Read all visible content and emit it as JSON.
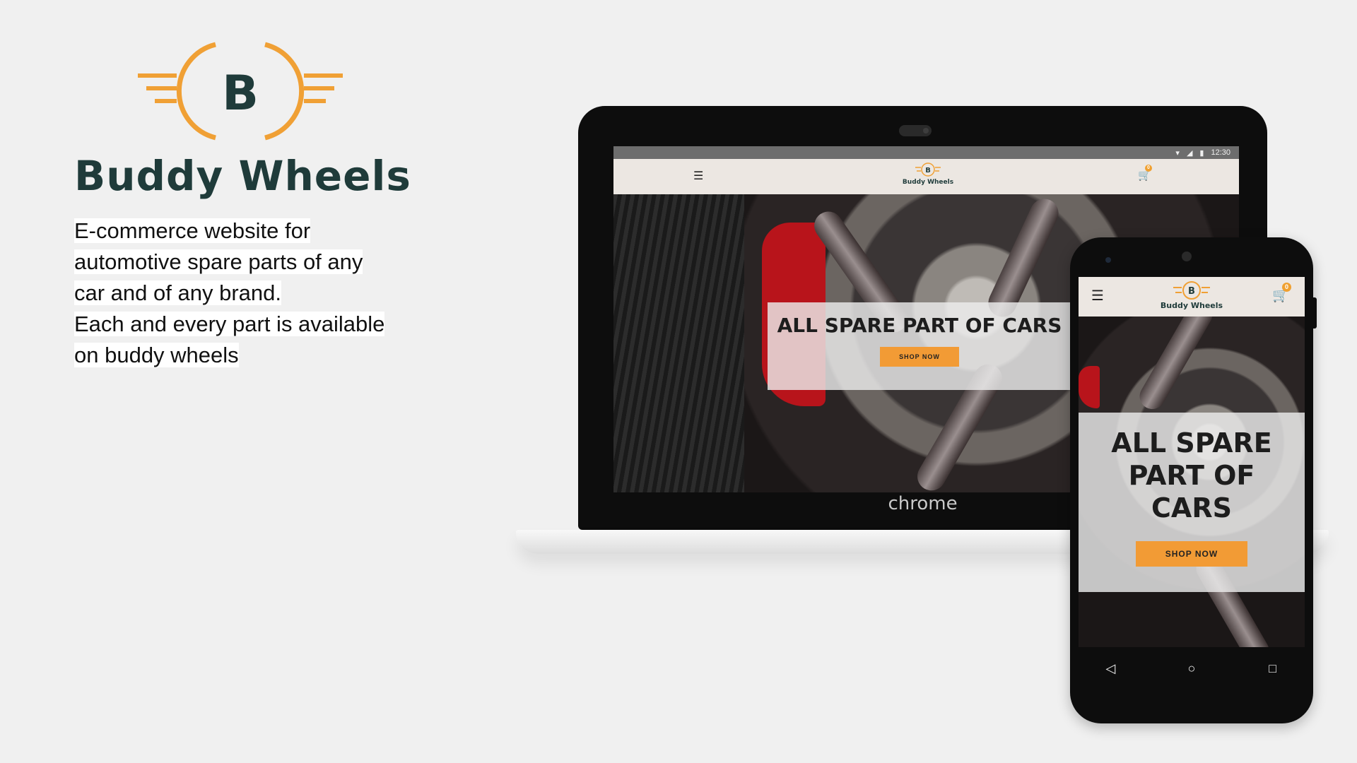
{
  "brand": {
    "logo_letter": "B",
    "name": "Buddy Wheels",
    "description_lines": [
      "E-commerce website for",
      "automotive spare parts of any",
      "car and of any brand.",
      "Each and every part is available",
      "on buddy wheels"
    ]
  },
  "colors": {
    "accent": "#f29b35",
    "brand_dark": "#1f3b3a",
    "header_bg": "#ece7e2"
  },
  "laptop": {
    "chin_label": "chrome",
    "status_time": "12:30",
    "site": {
      "menu_icon": "☰",
      "logo_letter": "B",
      "logo_text": "Buddy Wheels",
      "cart_count": "0",
      "hero_title": "ALL SPARE PART OF CARS",
      "cta": "SHOP NOW"
    }
  },
  "phone": {
    "site": {
      "menu_icon": "☰",
      "logo_letter": "B",
      "logo_text": "Buddy Wheels",
      "cart_count": "0",
      "hero_title": "ALL SPARE PART OF CARS",
      "cta": "SHOP NOW"
    },
    "nav": {
      "back": "◁",
      "home": "○",
      "recents": "□"
    }
  }
}
